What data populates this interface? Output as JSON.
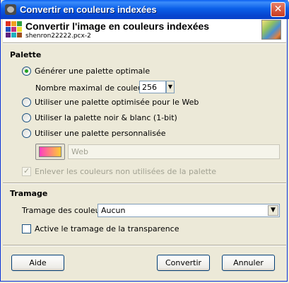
{
  "window": {
    "title": "Convertir en couleurs indexées",
    "close_glyph": "✕"
  },
  "header": {
    "title": "Convertir l'image en couleurs indexées",
    "subtitle": "shenron22222.pcx-2"
  },
  "palette": {
    "section_label": "Palette",
    "options": [
      {
        "label": "Générer une palette optimale",
        "checked": true
      },
      {
        "label": "Utiliser une palette optimisée pour le Web",
        "checked": false
      },
      {
        "label": "Utiliser la palette noir & blanc (1-bit)",
        "checked": false
      },
      {
        "label": "Utiliser une palette personnalisée",
        "checked": false
      }
    ],
    "max_colors_label": "Nombre maximal de couleurs :",
    "max_colors_value": "256",
    "custom_palette_name": "Web",
    "remove_unused_label": "Enlever les couleurs non utilisées de la palette",
    "remove_unused_checked": true
  },
  "dithering": {
    "section_label": "Tramage",
    "color_dither_label": "Tramage des couleurs",
    "color_dither_value": "Aucun",
    "transparency_label": "Active le tramage de la transparence",
    "transparency_checked": false
  },
  "buttons": {
    "help": "Aide",
    "convert": "Convertir",
    "cancel": "Annuler"
  },
  "colors": {
    "titlebar": "#0A5FF1",
    "dialog_bg": "#ECE9D8",
    "radio_check": "#21A121"
  },
  "icons": {
    "title": "gimp-icon",
    "header": "indexed-palette-icon",
    "thumb": "image-thumbnail",
    "spin": "spin-down-icon",
    "dropdown": "dropdown-arrow-icon"
  }
}
